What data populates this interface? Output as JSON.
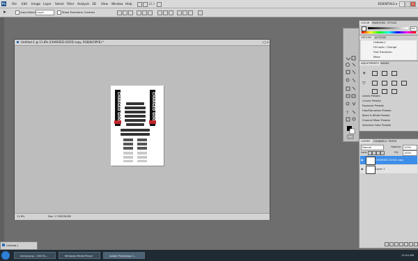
{
  "app": {
    "logo": "Ps",
    "workspace": "ESSENTIALS ▾",
    "zoom_display": "33.3"
  },
  "menu": [
    "File",
    "Edit",
    "Image",
    "Layer",
    "Select",
    "Filter",
    "Analysis",
    "3D",
    "View",
    "Window",
    "Help"
  ],
  "options_bar": {
    "auto_select_label": "Auto-Select:",
    "auto_select_value": "Layer",
    "transform_label": "Show Transform Controls"
  },
  "document": {
    "title": "Untitled-1 @ 11.8% (CHARGED GOOD copy, RGB/8/CMYK) *",
    "status_zoom": "11.8%",
    "status_doc": "Doc: 17.0M/28.8M",
    "artwork": {
      "text_left": "CHARGED GOOD",
      "text_right": "CHARGED GOOD",
      "text_top": "IT IS NOT GOOD",
      "text_mid": "ENOUGH"
    }
  },
  "color_panel": {
    "tabs": [
      "COLOR",
      "SWATCHES",
      "STYLES"
    ],
    "value": "255"
  },
  "history_panel": {
    "tabs": [
      "HISTORY",
      "ACTIONS"
    ],
    "items": [
      "Untitled-1",
      "Fill Layer / Change",
      "Free Transform",
      "Move"
    ]
  },
  "adjustments_panel": {
    "tabs": [
      "ADJUSTMENTS",
      "MASKS"
    ],
    "presets": [
      "Levels Presets",
      "Curves Presets",
      "Exposure Presets",
      "Hue/Saturation Presets",
      "Black & White Presets",
      "Channel Mixer Presets",
      "Selective Color Presets"
    ]
  },
  "layers_panel": {
    "tabs": [
      "LAYERS",
      "CHANNELS",
      "PATHS"
    ],
    "blend": "Normal",
    "opacity_label": "Opacity:",
    "opacity": "100%",
    "lock_label": "Lock:",
    "fill_label": "Fill:",
    "fill": "100%",
    "layers": [
      {
        "name": "CHARGED GOOD copy",
        "selected": true
      },
      {
        "name": "Layer 1",
        "selected": false
      }
    ]
  },
  "minimized": {
    "label": "Untitled-1"
  },
  "taskbar": {
    "buttons": [
      "slrclub.png - Chill Fa...",
      "Windows Media Player",
      "Adobe Photoshop C..."
    ],
    "time": "12:44 AM"
  },
  "colors": {
    "accent": "#3d8ee9",
    "selected_layer": "#3d8ee9",
    "artwork_red": "#c0262b"
  }
}
